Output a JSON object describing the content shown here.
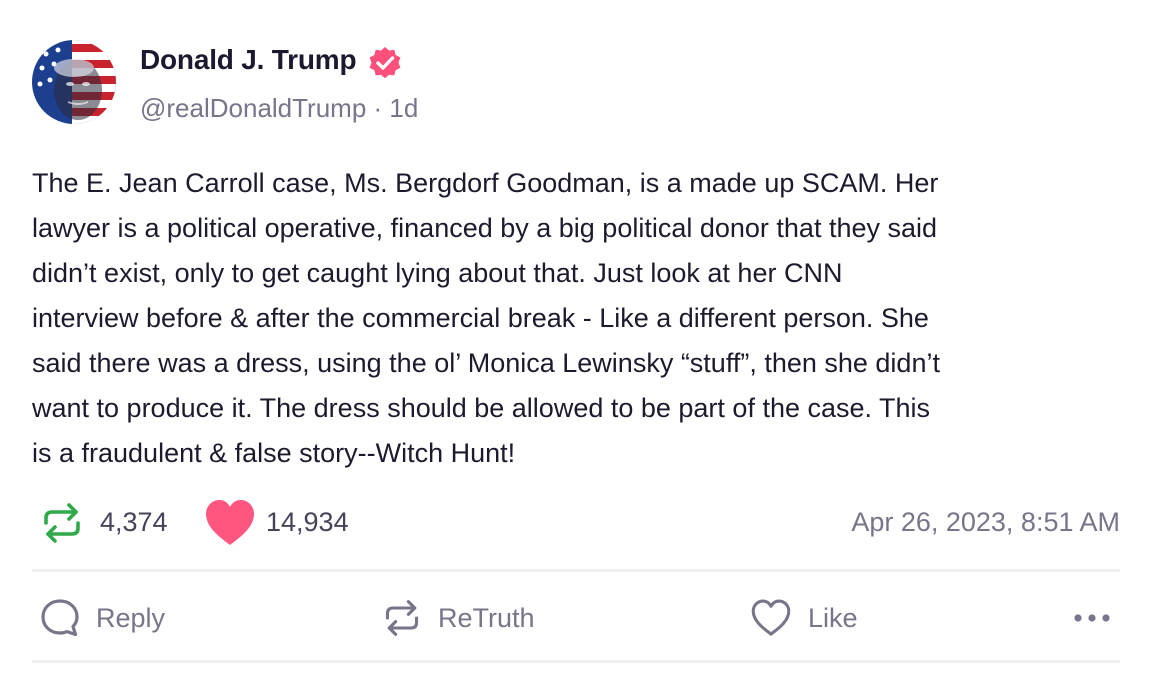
{
  "author": {
    "name": "Donald J. Trump",
    "handle": "@realDonaldTrump",
    "separator": " · ",
    "time_ago": "1d"
  },
  "post": {
    "text": "The E. Jean Carroll case, Ms. Bergdorf Goodman, is a made up SCAM. Her\nlawyer is a political operative, financed by a big political donor that they said\ndidn’t exist, only to get caught lying about that. Just look at her CNN\ninterview before & after the commercial break - Like a different person. She\nsaid there was a dress, using the ol’ Monica Lewinsky “stuff”, then she didn’t\nwant to produce it. The dress should be allowed to be part of the case. This\nis a fraudulent & false story--Witch Hunt!"
  },
  "stats": {
    "retruths": "4,374",
    "likes": "14,934",
    "timestamp": "Apr 26, 2023, 8:51 AM"
  },
  "actions": {
    "reply_label": "Reply",
    "retruth_label": "ReTruth",
    "like_label": "Like"
  },
  "icons": {
    "verified": "verified-badge-icon",
    "retruth_stat": "retruth-icon",
    "like_stat": "heart-icon",
    "reply": "reply-icon",
    "retruth": "retruth-icon",
    "like": "heart-outline-icon",
    "more": "more-icon"
  },
  "colors": {
    "text": "#1c1b2e",
    "muted": "#76758a",
    "verified": "#ff4f7b",
    "retruth_green": "#2fa94a",
    "like_pink": "#ff5680",
    "divider": "#eeeef2"
  }
}
